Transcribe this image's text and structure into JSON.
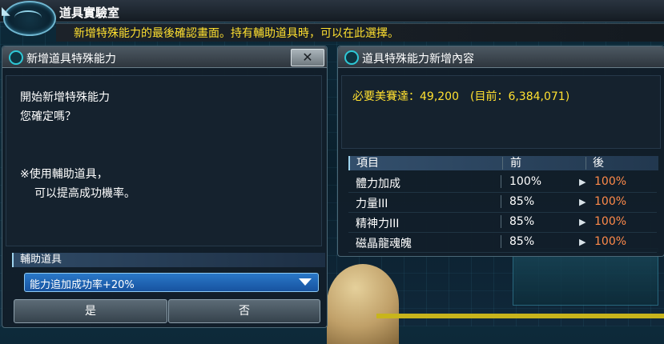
{
  "window": {
    "title": "道具實驗室",
    "info_message": "新增特殊能力的最後確認畫面。持有輔助道具時，可以在此選擇。"
  },
  "left_panel": {
    "title": "新增道具特殊能力",
    "close_label": "✕",
    "message_line1": "開始新增特殊能力",
    "message_line2": "您確定嗎？",
    "note_line1": "※使用輔助道具，",
    "note_line2": "可以提高成功機率。",
    "aux_item_label": "輔助道具",
    "aux_item_selected": "能力追加成功率+20%",
    "yes_label": "是",
    "no_label": "否"
  },
  "right_panel": {
    "title": "道具特殊能力新增內容",
    "cost_text": "必要美賽達：49,200　(目前：6,384,071)",
    "table": {
      "columns": [
        "項目",
        "前",
        "後"
      ],
      "rows": [
        {
          "name": "體力加成",
          "before": "100%",
          "after": "100%"
        },
        {
          "name": "力量III",
          "before": "85%",
          "after": "100%"
        },
        {
          "name": "精神力III",
          "before": "85%",
          "after": "100%"
        },
        {
          "name": "磁晶龍魂魄",
          "before": "85%",
          "after": "100%"
        }
      ]
    }
  },
  "colors": {
    "highlight_yellow": "#ffe030",
    "after_value_orange": "#ff8a4a",
    "dropdown_blue": "#2a78c8"
  },
  "icons": {
    "close": "close-icon",
    "dropdown": "chevron-down-icon",
    "row_arrow": "arrow-right-icon"
  }
}
